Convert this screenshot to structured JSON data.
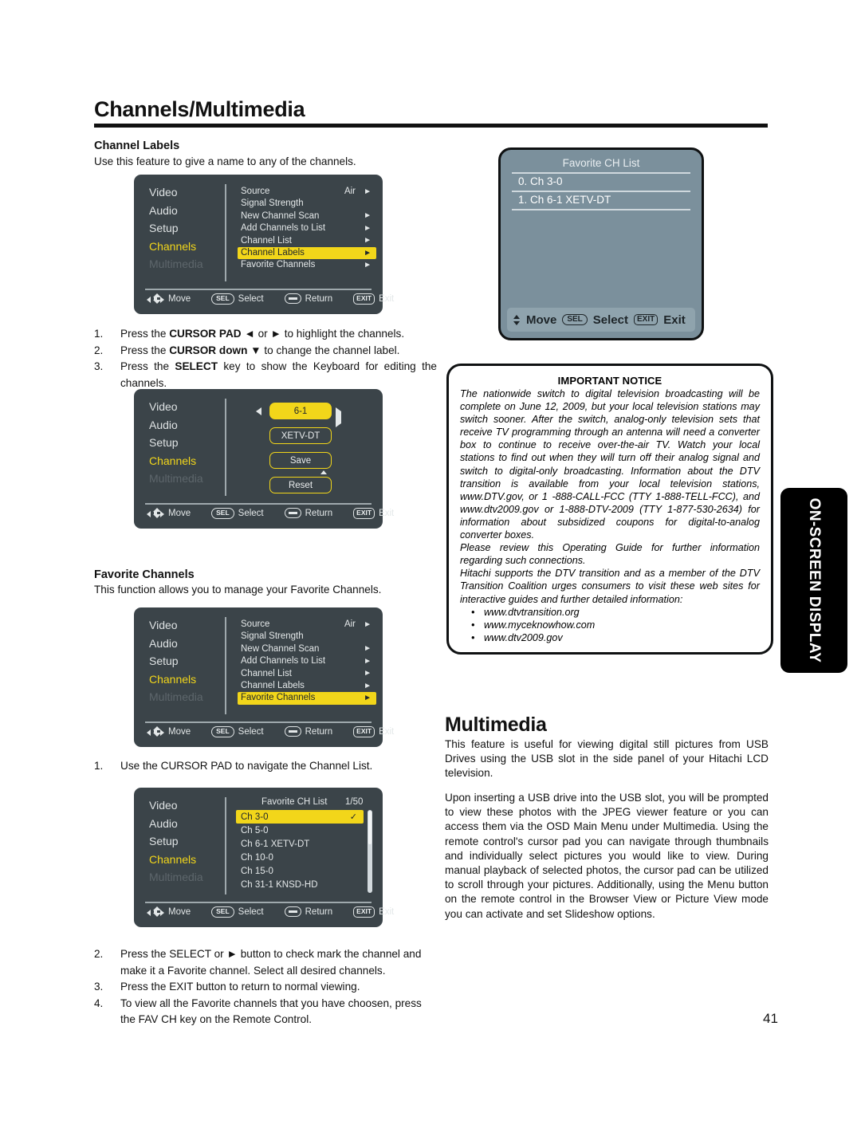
{
  "page": {
    "title": "Channels/Multimedia",
    "number": "41",
    "side_tab": "ON-SCREEN DISPLAY"
  },
  "channel_labels": {
    "heading": "Channel Labels",
    "description": "Use this feature to give a name to any of the channels.",
    "steps": [
      {
        "n": "1.",
        "text": "Press the CURSOR PAD ◄ or ► to highlight the channels."
      },
      {
        "n": "2.",
        "text": "Press the CURSOR down ▼ to change the channel label."
      },
      {
        "n": "3.",
        "text": "Press the SELECT key to show the Keyboard for editing the channels."
      }
    ]
  },
  "favorite_channels": {
    "heading": "Favorite Channels",
    "description": "This function allows you to manage your Favorite Channels.",
    "step1": {
      "n": "1.",
      "text": "Use the CURSOR PAD to navigate the Channel List."
    },
    "steps": [
      {
        "n": "2.",
        "text": "Press the SELECT or ► button to check mark the channel and make it a Favorite channel. Select all desired channels."
      },
      {
        "n": "3.",
        "text": "Press the EXIT button to return to normal viewing."
      },
      {
        "n": "4.",
        "text": "To view all the Favorite channels that you have choosen, press the FAV CH key on the Remote Control."
      }
    ]
  },
  "osd_common": {
    "left_menu": [
      "Video",
      "Audio",
      "Setup",
      "Channels",
      "Multimedia"
    ],
    "selected_left": "Channels",
    "dimmed_left": "Multimedia",
    "legend": {
      "move": "Move",
      "select": "Select",
      "return": "Return",
      "exit": "Exit",
      "sel_key": "SEL",
      "exit_key": "EXIT"
    },
    "colors": {
      "panel_bg": "#3b4449",
      "highlight": "#f2d61a",
      "text": "#e4e8e9",
      "dim_text": "#5d666b",
      "fav_panel_bg": "#7b909c"
    }
  },
  "osd_menu_1": {
    "rows": [
      {
        "label": "Source",
        "value": "Air",
        "arrow": "►",
        "highlight": false
      },
      {
        "label": "Signal Strength",
        "value": "",
        "arrow": "",
        "highlight": false
      },
      {
        "label": "New Channel Scan",
        "value": "",
        "arrow": "►",
        "highlight": false
      },
      {
        "label": "Add Channels to List",
        "value": "",
        "arrow": "►",
        "highlight": false
      },
      {
        "label": "Channel List",
        "value": "",
        "arrow": "►",
        "highlight": false
      },
      {
        "label": "Channel Labels",
        "value": "",
        "arrow": "►",
        "highlight": true
      },
      {
        "label": "Favorite Channels",
        "value": "",
        "arrow": "►",
        "highlight": false
      }
    ]
  },
  "osd_menu_2": {
    "rows": [
      {
        "label": "Source",
        "value": "Air",
        "arrow": "►",
        "highlight": false
      },
      {
        "label": "Signal Strength",
        "value": "",
        "arrow": "",
        "highlight": false
      },
      {
        "label": "New Channel Scan",
        "value": "",
        "arrow": "►",
        "highlight": false
      },
      {
        "label": "Add Channels to List",
        "value": "",
        "arrow": "►",
        "highlight": false
      },
      {
        "label": "Channel List",
        "value": "",
        "arrow": "►",
        "highlight": false
      },
      {
        "label": "Channel Labels",
        "value": "",
        "arrow": "►",
        "highlight": false
      },
      {
        "label": "Favorite Channels",
        "value": "",
        "arrow": "►",
        "highlight": true
      }
    ]
  },
  "osd_editor": {
    "channel_number": "6-1",
    "channel_name": "XETV-DT",
    "save": "Save",
    "reset": "Reset"
  },
  "osd_fav_list": {
    "title": "Favorite CH List",
    "counter": "1/50",
    "items": [
      {
        "label": "Ch 3-0",
        "checked": true,
        "highlight": true
      },
      {
        "label": "Ch 5-0",
        "checked": false,
        "highlight": false
      },
      {
        "label": "Ch 6-1 XETV-DT",
        "checked": false,
        "highlight": false
      },
      {
        "label": "Ch 10-0",
        "checked": false,
        "highlight": false
      },
      {
        "label": "Ch 15-0",
        "checked": false,
        "highlight": false
      },
      {
        "label": "Ch 31-1 KNSD-HD",
        "checked": false,
        "highlight": false
      }
    ],
    "check_glyph": "✓"
  },
  "fav_ch_popup": {
    "title": "Favorite CH List",
    "items": [
      "0. Ch 3-0",
      "1. Ch 6-1 XETV-DT"
    ],
    "legend": {
      "move": "Move",
      "select": "Select",
      "exit": "Exit",
      "sel_key": "SEL",
      "exit_key": "EXIT"
    }
  },
  "notice": {
    "heading": "IMPORTANT NOTICE",
    "paragraphs": [
      "The nationwide switch to digital television broadcasting will be complete on June 12, 2009, but your local television stations may switch sooner. After the switch, analog-only television sets that receive TV programming through an antenna will need a converter box to continue to receive over-the-air TV. Watch your local stations to find out when they will turn off their analog signal and switch to digital-only broadcasting. Information about the DTV transition is available from your local television stations, www.DTV.gov, or 1 -888-CALL-FCC (TTY 1-888-TELL-FCC), and www.dtv2009.gov or 1-888-DTV-2009 (TTY 1-877-530-2634) for information about subsidized coupons for digital-to-analog converter boxes.",
      "Please review this Operating Guide for further information regarding such connections.",
      "Hitachi supports the DTV transition and as a member of the DTV Transition Coalition urges consumers to visit these web sites for interactive guides and further detailed information:"
    ],
    "links": [
      "www.dtvtransition.org",
      "www.myceknowhow.com",
      "www.dtv2009.gov"
    ]
  },
  "multimedia": {
    "heading": "Multimedia",
    "paragraph1": "This feature is useful for viewing digital still pictures from USB Drives using the USB slot in the side panel of your Hitachi LCD television.",
    "paragraph2": "Upon inserting a USB drive into the USB slot, you will be prompted to view these photos with the JPEG viewer feature or you can access them via the OSD Main Menu under Multimedia.  Using the remote control's cursor pad you can navigate through thumbnails and individually select pictures you would like to view.  During manual playback of selected photos, the cursor pad can be utilized to scroll through your pictures.  Additionally, using the Menu button on the remote control in the Browser View or Picture View mode you can activate and set Slideshow options."
  }
}
